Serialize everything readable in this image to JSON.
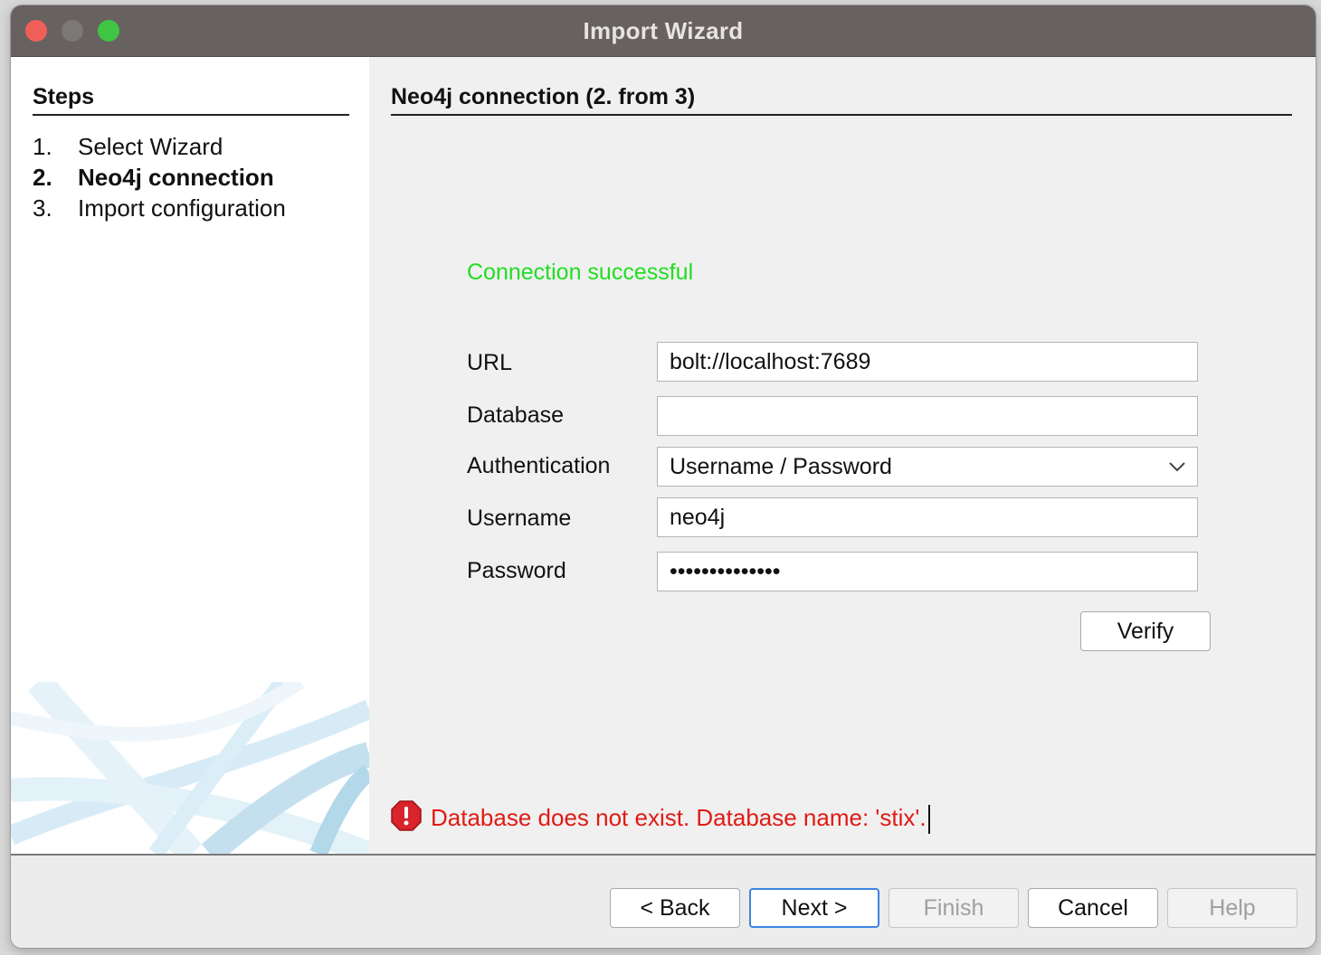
{
  "window": {
    "title": "Import Wizard"
  },
  "steps": {
    "heading": "Steps",
    "items": [
      {
        "num": "1.",
        "label": "Select Wizard",
        "active": false
      },
      {
        "num": "2.",
        "label": "Neo4j connection",
        "active": true
      },
      {
        "num": "3.",
        "label": "Import configuration",
        "active": false
      }
    ]
  },
  "main": {
    "title": "Neo4j connection (2. from 3)",
    "status": "Connection successful",
    "form": {
      "url": {
        "label": "URL",
        "value": "bolt://localhost:7689"
      },
      "database": {
        "label": "Database",
        "value": ""
      },
      "authentication": {
        "label": "Authentication",
        "value": "Username / Password"
      },
      "username": {
        "label": "Username",
        "value": "neo4j"
      },
      "password": {
        "label": "Password",
        "value": "••••••••••••••"
      }
    },
    "verify_label": "Verify",
    "error": "Database does not exist. Database name: 'stix'."
  },
  "footer": {
    "back_label": "< Back",
    "next_label": "Next >",
    "finish_label": "Finish",
    "cancel_label": "Cancel",
    "help_label": "Help"
  },
  "colors": {
    "success": "#22dd22",
    "error": "#e11a14",
    "focus": "#3e86e0",
    "titlebar": "#676160"
  }
}
